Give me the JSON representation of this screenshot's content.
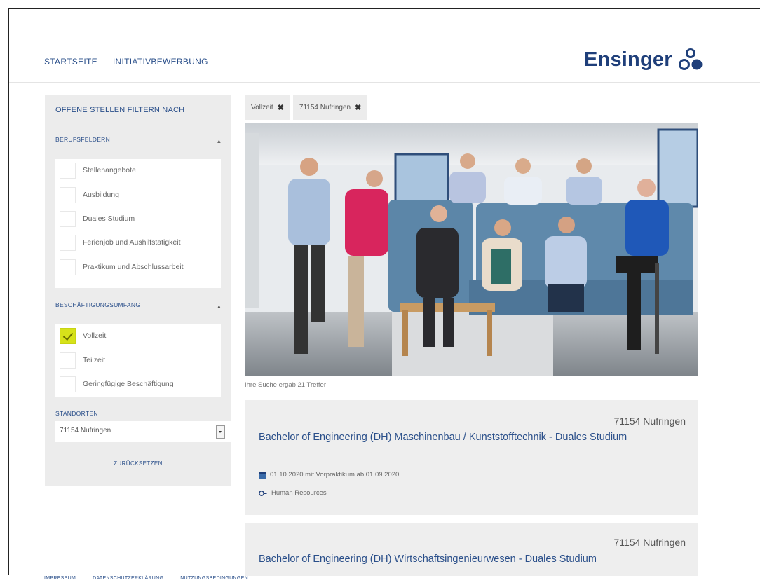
{
  "colors": {
    "brand": "#1f3f7a",
    "link": "#2a4f8a",
    "check_accent": "#d6e21a",
    "panel": "#ececec"
  },
  "nav": {
    "home": "STARTSEITE",
    "initiative": "INITIATIVBEWERBUNG"
  },
  "logo": {
    "text": "Ensinger"
  },
  "sidebar": {
    "title": "OFFENE STELLEN FILTERN NACH",
    "fields_heading": "BERUFSFELDERN",
    "fields": [
      "Stellenangebote",
      "Ausbildung",
      "Duales Studium",
      "Ferienjob und Aushilfstätigkeit",
      "Praktikum und Abschlussarbeit"
    ],
    "scope_heading": "BESCHÄFTIGUNGSUMFANG",
    "scope": [
      {
        "label": "Vollzeit",
        "checked": true
      },
      {
        "label": "Teilzeit",
        "checked": false
      },
      {
        "label": "Geringfügige Beschäftigung",
        "checked": false
      }
    ],
    "locations_heading": "STANDORTEN",
    "location_value": "71154 Nufringen",
    "reset_label": "ZURÜCKSETZEN"
  },
  "chips": [
    {
      "label": "Vollzeit",
      "remove_icon": "close-icon"
    },
    {
      "label": "71154 Nufringen",
      "remove_icon": "close-icon"
    }
  ],
  "results_text": "Ihre Suche ergab 21 Treffer",
  "jobs": [
    {
      "location": "71154 Nufringen",
      "title": "Bachelor of Engineering (DH) Maschinenbau / Kunststofftechnik - Duales Studium",
      "date": "01.10.2020 mit Vorpraktikum ab 01.09.2020",
      "department": "Human Resources"
    },
    {
      "location": "71154 Nufringen",
      "title": "Bachelor of Engineering (DH) Wirtschaftsingenieurwesen - Duales Studium"
    }
  ],
  "footer": {
    "imprint": "IMPRESSUM",
    "privacy": "DATENSCHUTZERKLÄRUNG",
    "terms": "NUTZUNGSBEDINGUNGEN"
  }
}
